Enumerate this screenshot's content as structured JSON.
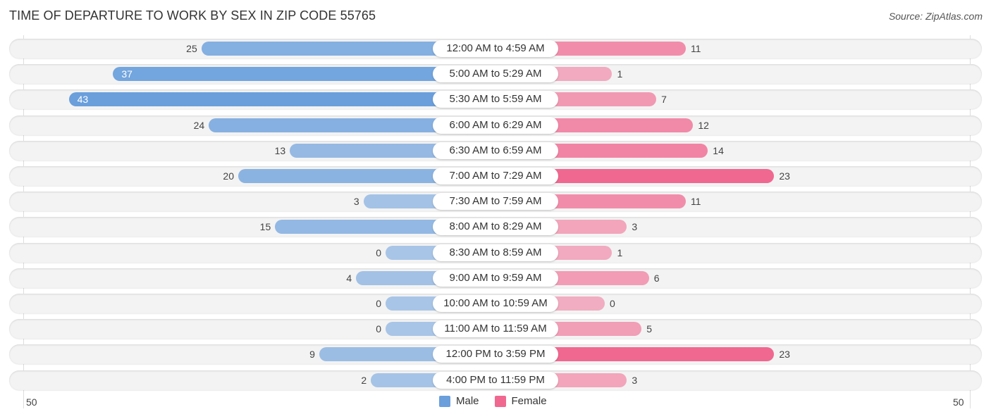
{
  "chart_data": {
    "type": "bar",
    "orientation": "horizontal-diverging",
    "title": "TIME OF DEPARTURE TO WORK BY SEX IN ZIP CODE 55765",
    "source": "Source: ZipAtlas.com",
    "categories": [
      "12:00 AM to 4:59 AM",
      "5:00 AM to 5:29 AM",
      "5:30 AM to 5:59 AM",
      "6:00 AM to 6:29 AM",
      "6:30 AM to 6:59 AM",
      "7:00 AM to 7:29 AM",
      "7:30 AM to 7:59 AM",
      "8:00 AM to 8:29 AM",
      "8:30 AM to 8:59 AM",
      "9:00 AM to 9:59 AM",
      "10:00 AM to 10:59 AM",
      "11:00 AM to 11:59 AM",
      "12:00 PM to 3:59 PM",
      "4:00 PM to 11:59 PM"
    ],
    "series": [
      {
        "name": "Male",
        "color": "#6a9fdc",
        "values": [
          25,
          37,
          43,
          24,
          13,
          20,
          3,
          15,
          0,
          4,
          0,
          0,
          9,
          2
        ]
      },
      {
        "name": "Female",
        "color": "#f06890",
        "values": [
          11,
          1,
          7,
          12,
          14,
          23,
          11,
          3,
          1,
          6,
          0,
          5,
          23,
          3
        ]
      }
    ],
    "axis": {
      "left_tick": "50",
      "right_tick": "50",
      "range": [
        0,
        50
      ]
    },
    "legend": {
      "position": "bottom-center",
      "items": [
        "Male",
        "Female"
      ]
    },
    "xlabel": "",
    "ylabel": ""
  }
}
